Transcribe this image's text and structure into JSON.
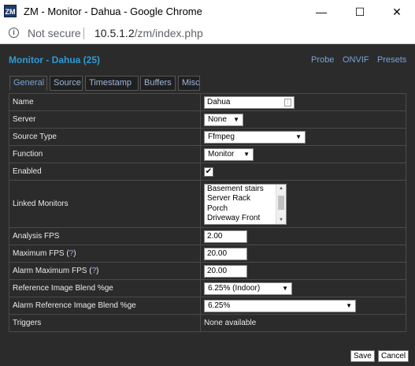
{
  "window": {
    "app_icon_text": "ZM",
    "title": "ZM - Monitor - Dahua - Google Chrome",
    "minimize_glyph": "—",
    "maximize_glyph": "☐",
    "close_glyph": "✕"
  },
  "address_bar": {
    "security_label": "Not secure",
    "url_host": "10.5.1.2",
    "url_path": "/zm/index.php"
  },
  "page": {
    "heading": "Monitor - Dahua (25)",
    "links": {
      "probe": "Probe",
      "onvif": "ONVIF",
      "presets": "Presets"
    }
  },
  "tabs": [
    "General",
    "Source",
    "Timestamp",
    "Buffers",
    "Misc"
  ],
  "form": {
    "name": {
      "label": "Name",
      "value": "Dahua"
    },
    "server": {
      "label": "Server",
      "value": "None"
    },
    "source_type": {
      "label": "Source Type",
      "value": "Ffmpeg"
    },
    "function": {
      "label": "Function",
      "value": "Monitor"
    },
    "enabled": {
      "label": "Enabled",
      "checked": true,
      "glyph": "✔"
    },
    "linked_monitors": {
      "label": "Linked Monitors",
      "options": [
        "Basement stairs",
        "Server Rack",
        "Porch",
        "Driveway Front"
      ]
    },
    "analysis_fps": {
      "label": "Analysis FPS",
      "value": "2.00"
    },
    "maximum_fps": {
      "label": "Maximum FPS (",
      "help": "?",
      "label_end": ")",
      "value": "20.00"
    },
    "alarm_maximum_fps": {
      "label": "Alarm Maximum FPS (",
      "help": "?",
      "label_end": ")",
      "value": "20.00"
    },
    "reference_blend": {
      "label": "Reference Image Blend %ge",
      "value": "6.25% (Indoor)"
    },
    "alarm_reference_blend": {
      "label": "Alarm Reference Image Blend %ge",
      "value": "6.25%"
    },
    "triggers": {
      "label": "Triggers",
      "value": "None available"
    }
  },
  "buttons": {
    "save": "Save",
    "cancel": "Cancel"
  },
  "colors": {
    "heading": "#2d9bd6",
    "link": "#7aa2d6",
    "background": "#2b2b2b"
  }
}
